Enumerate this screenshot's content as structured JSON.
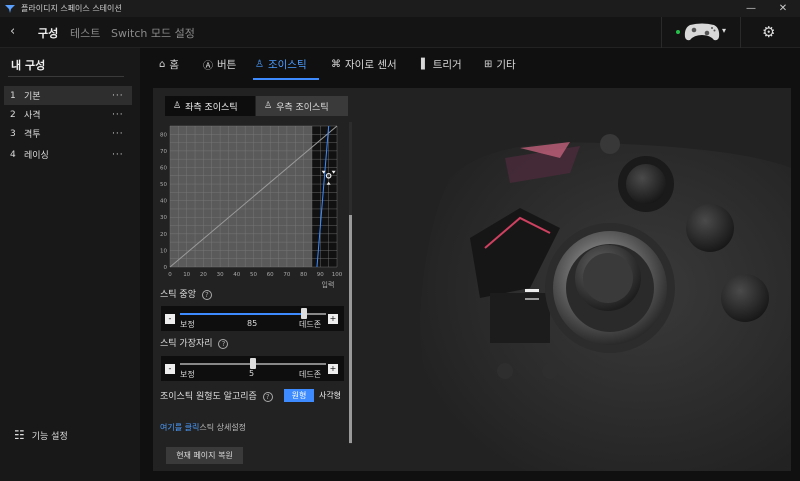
{
  "window": {
    "title": "플라이디지 스페이스 스테이션",
    "minimize": "—",
    "close": "✕"
  },
  "nav": {
    "back": "‹",
    "items": [
      "구성",
      "테스트",
      "Switch 모드 설정"
    ],
    "caret": "▾",
    "gear": "⚙"
  },
  "sidebar": {
    "heading": "내 구성",
    "profiles": [
      {
        "num": "1",
        "name": "기본"
      },
      {
        "num": "2",
        "name": "사격"
      },
      {
        "num": "3",
        "name": "격투"
      },
      {
        "num": "4",
        "name": "레이싱"
      }
    ],
    "more": "···",
    "settings_icon": "☷",
    "settings_label": "기능 설정"
  },
  "tabs": [
    {
      "icon": "⌂",
      "label": "홈"
    },
    {
      "icon": "Ⓐ",
      "label": "버튼"
    },
    {
      "icon": "♙",
      "label": "조이스틱"
    },
    {
      "icon": "⌘",
      "label": "자이로 센서"
    },
    {
      "icon": "▌",
      "label": "트리거"
    },
    {
      "icon": "⊞",
      "label": "기타"
    }
  ],
  "subtabs": {
    "left": {
      "icon": "♙",
      "label": "좌측 조이스틱"
    },
    "right": {
      "icon": "♙",
      "label": "우측 조이스틱"
    }
  },
  "chart_data": {
    "type": "line",
    "xlabel": "입력",
    "x_ticks": [
      0,
      10,
      20,
      30,
      40,
      50,
      60,
      70,
      80,
      90,
      100
    ],
    "y_ticks": [
      0,
      10,
      20,
      30,
      40,
      50,
      60,
      70,
      80
    ],
    "xlim": [
      0,
      100
    ],
    "ylim": [
      0,
      85
    ],
    "grid": true,
    "deadzone_range": [
      85,
      100
    ],
    "series": [
      {
        "x": [
          0,
          100
        ],
        "y": [
          0,
          85
        ],
        "color": "#9a9a9a"
      },
      {
        "x": [
          88,
          95
        ],
        "y": [
          0,
          85
        ],
        "color": "#3d8bff"
      }
    ],
    "markers": [
      {
        "x": 95,
        "y": 55
      }
    ],
    "colors": {
      "plot_bg": "#5a5a5a",
      "grid": "#7c7c7c",
      "axis_text": "#aaaaaa"
    }
  },
  "center": {
    "label": "스틱 중앙",
    "help": "?",
    "minus": "-",
    "plus": "+",
    "left_label": "보정",
    "right_label": "데드존",
    "value": "85",
    "fraction": 0.85
  },
  "edge": {
    "label": "스틱 가장자리",
    "help": "?",
    "minus": "-",
    "plus": "+",
    "left_label": "보정",
    "right_label": "데드존",
    "value": "5",
    "fraction": 0.5
  },
  "algorithm": {
    "label": "조이스틱 원형도 알고리즘",
    "help": "?",
    "options": [
      "원형",
      "사각형"
    ],
    "selected": "원형"
  },
  "link": {
    "click_text": "여기를 클릭",
    "rest_text": "스틱 상세설정"
  },
  "reset_button": "현재 페이지 복원",
  "accent": "#3d8bff"
}
